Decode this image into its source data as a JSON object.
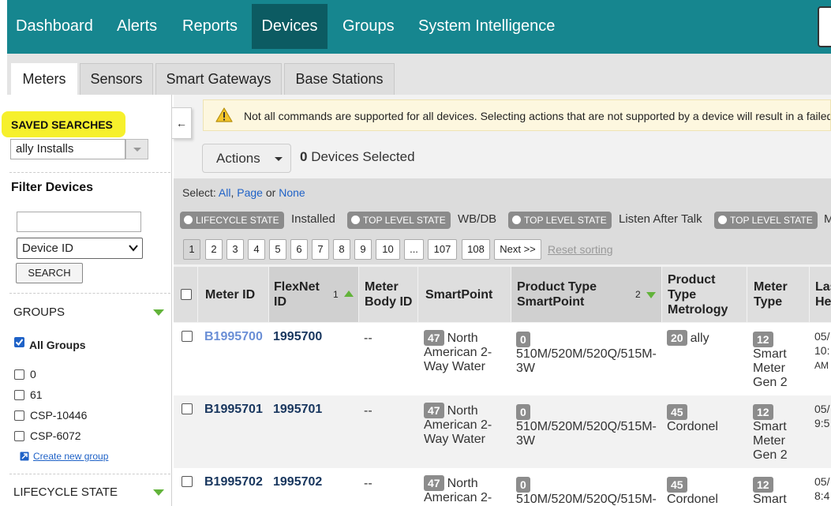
{
  "topnav": {
    "items": [
      "Dashboard",
      "Alerts",
      "Reports",
      "Devices",
      "Groups",
      "System Intelligence"
    ],
    "active": "Devices"
  },
  "tabs": [
    "Meters",
    "Sensors",
    "Smart Gateways",
    "Base Stations"
  ],
  "sidebar": {
    "saved_searches_title": "SAVED SEARCHES",
    "saved_search_value": "ally Installs",
    "filter_title": "Filter Devices",
    "filter_input_value": "",
    "filter_field": "Device ID",
    "search_button": "SEARCH",
    "groups_title": "GROUPS",
    "all_groups_label": "All Groups",
    "groups": [
      "0",
      "61",
      "CSP-10446",
      "CSP-6072"
    ],
    "create_group_link": "Create new group",
    "lifecycle_title": "LIFECYCLE STATE",
    "collapse_glyph": "←"
  },
  "warning": {
    "text": "Not all commands are supported for all devices. Selecting actions that are not supported by a device will result in a failed a"
  },
  "toolbar": {
    "actions_label": "Actions",
    "selected_count": "0",
    "selected_suffix": " Devices Selected"
  },
  "select": {
    "prefix": "Select: ",
    "all": "All",
    "comma": ", ",
    "page": "Page",
    "or": " or ",
    "none": "None"
  },
  "filters": [
    {
      "label": "LIFECYCLE STATE",
      "value": "Installed"
    },
    {
      "label": "TOP LEVEL STATE",
      "value": "WB/DB"
    },
    {
      "label": "TOP LEVEL STATE",
      "value": "Listen After Talk"
    },
    {
      "label": "TOP LEVEL STATE",
      "value": "M"
    }
  ],
  "pagination": {
    "pages": [
      "1",
      "2",
      "3",
      "4",
      "5",
      "6",
      "7",
      "8",
      "9",
      "10",
      "...",
      "107",
      "108"
    ],
    "current": "1",
    "next_label": "Next >>",
    "reset_label": "Reset sorting"
  },
  "table": {
    "columns": [
      {
        "label": "Meter ID"
      },
      {
        "label": "FlexNet ID",
        "sort_order": "1",
        "sort_dir": "asc"
      },
      {
        "label": "Meter Body ID"
      },
      {
        "label": "SmartPoint"
      },
      {
        "label": "Product Type SmartPoint",
        "sort_order": "2",
        "sort_dir": "desc"
      },
      {
        "label": "Product Type Metrology"
      },
      {
        "label": "Meter Type"
      },
      {
        "label": "Las He"
      }
    ],
    "rows": [
      {
        "meter_id": "B1995700",
        "flexnet_id": "1995700",
        "body_id": "--",
        "sp_code": "47",
        "sp_text": "North American 2-Way Water",
        "pt_code": "0",
        "pt_text": "510M/520M/520Q/515M-3W",
        "met_code": "20",
        "met_text": "ally",
        "mt_code": "12",
        "mt_text": "Smart Meter Gen 2",
        "last_date": "05/",
        "last_time": "10:",
        "last_ampm": "AM"
      },
      {
        "meter_id": "B1995701",
        "flexnet_id": "1995701",
        "body_id": "--",
        "sp_code": "47",
        "sp_text": "North American 2-Way Water",
        "pt_code": "0",
        "pt_text": "510M/520M/520Q/515M-3W",
        "met_code": "45",
        "met_text": "Cordonel",
        "mt_code": "12",
        "mt_text": "Smart Meter Gen 2",
        "last_date": "05/",
        "last_time": "9:5",
        "last_ampm": ""
      },
      {
        "meter_id": "B1995702",
        "flexnet_id": "1995702",
        "body_id": "--",
        "sp_code": "47",
        "sp_text": "North American 2-",
        "pt_code": "0",
        "pt_text": "510M/520M/520Q/515M-",
        "met_code": "45",
        "met_text": "Cordonel",
        "mt_code": "12",
        "mt_text": "Smart",
        "last_date": "05/",
        "last_time": "8:4",
        "last_ampm": ""
      }
    ]
  },
  "colors": {
    "nav_bg": "#16868f",
    "nav_active": "#0c5b62",
    "link": "#1f62c7",
    "highlight": "#f6f02c",
    "sort_arrow": "#62b33a"
  }
}
